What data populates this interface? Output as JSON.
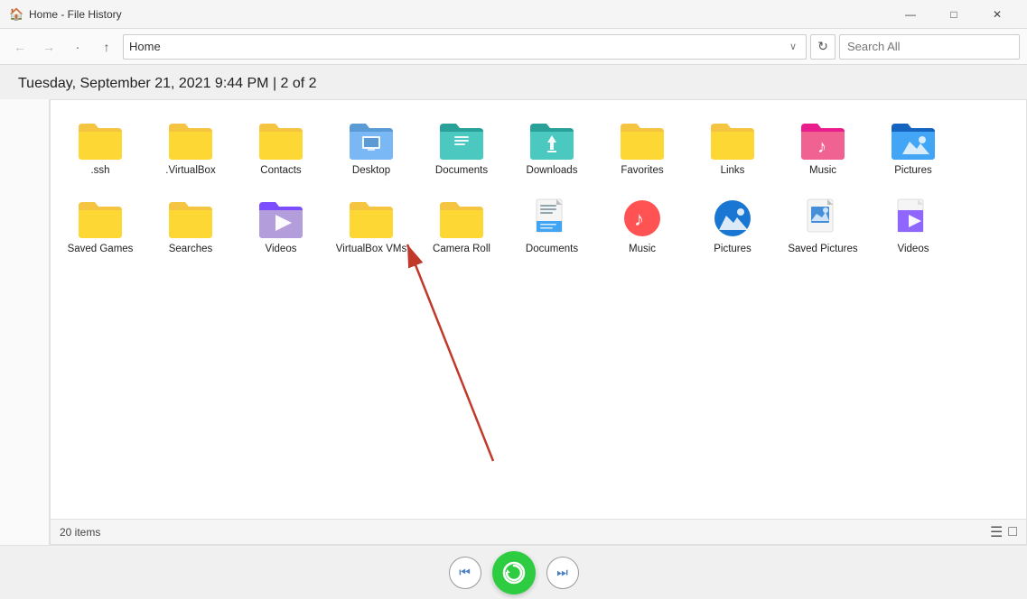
{
  "titlebar": {
    "icon": "🏠",
    "title": "Home - File History",
    "minimize_label": "—",
    "maximize_label": "□",
    "close_label": "✕"
  },
  "addressbar": {
    "back_label": "←",
    "forward_label": "→",
    "recent_label": "·",
    "up_label": "↑",
    "address_value": "Home",
    "search_placeholder": "Search All",
    "refresh_label": "↻"
  },
  "date_header": "Tuesday, September 21, 2021 9:44 PM   |   2 of 2",
  "files": [
    {
      "name": ".ssh",
      "type": "folder-generic"
    },
    {
      "name": ".VirtualBox",
      "type": "folder-generic"
    },
    {
      "name": "Contacts",
      "type": "folder-generic"
    },
    {
      "name": "Desktop",
      "type": "folder-blue"
    },
    {
      "name": "Documents",
      "type": "folder-teal-doc"
    },
    {
      "name": "Downloads",
      "type": "folder-download"
    },
    {
      "name": "Favorites",
      "type": "folder-generic"
    },
    {
      "name": "Links",
      "type": "folder-generic"
    },
    {
      "name": "Music",
      "type": "folder-music"
    },
    {
      "name": "Pictures",
      "type": "folder-pictures"
    },
    {
      "name": "Saved Games",
      "type": "folder-generic"
    },
    {
      "name": "Searches",
      "type": "folder-generic"
    },
    {
      "name": "Videos",
      "type": "folder-video"
    },
    {
      "name": "VirtualBox VMs",
      "type": "folder-generic"
    },
    {
      "name": "Camera Roll",
      "type": "folder-camera"
    },
    {
      "name": "Documents",
      "type": "doc-file"
    },
    {
      "name": "Music",
      "type": "music-file"
    },
    {
      "name": "Pictures",
      "type": "pictures-file"
    },
    {
      "name": "Saved Pictures",
      "type": "saved-pictures-file"
    },
    {
      "name": "Videos",
      "type": "video-file"
    }
  ],
  "status": {
    "item_count": "20 items"
  },
  "playback": {
    "prev_label": "⏮",
    "next_label": "⏭",
    "center_icon": "↺"
  }
}
